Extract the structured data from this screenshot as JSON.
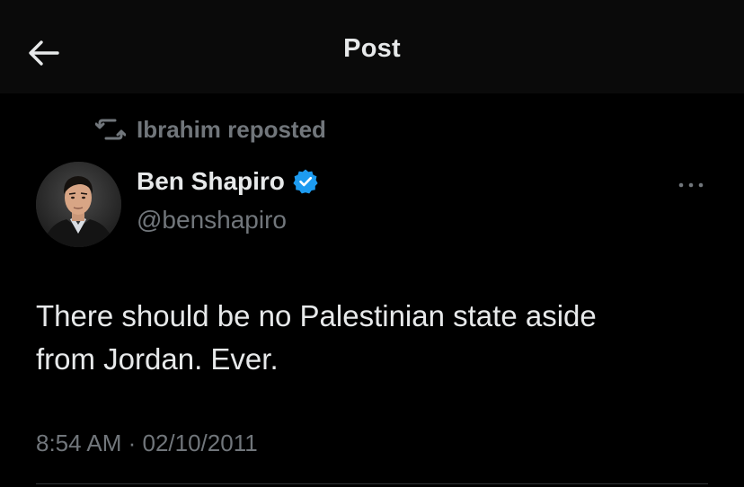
{
  "header": {
    "title": "Post",
    "back_icon": "arrow-left-icon"
  },
  "repost": {
    "icon": "repost-icon",
    "label": "Ibrahim reposted"
  },
  "author": {
    "name": "Ben Shapiro",
    "handle": "@benshapiro",
    "verified": true,
    "verified_color": "#1d9bf0"
  },
  "post": {
    "text": "There should be no Palestinian state aside\nfrom Jordan. Ever.",
    "timestamp": "8:54 AM · 02/10/2011"
  },
  "more_icon": "ellipsis-icon",
  "colors": {
    "background": "#000000",
    "text_primary": "#e7e9ea",
    "text_secondary": "#71767b",
    "accent": "#1d9bf0"
  }
}
